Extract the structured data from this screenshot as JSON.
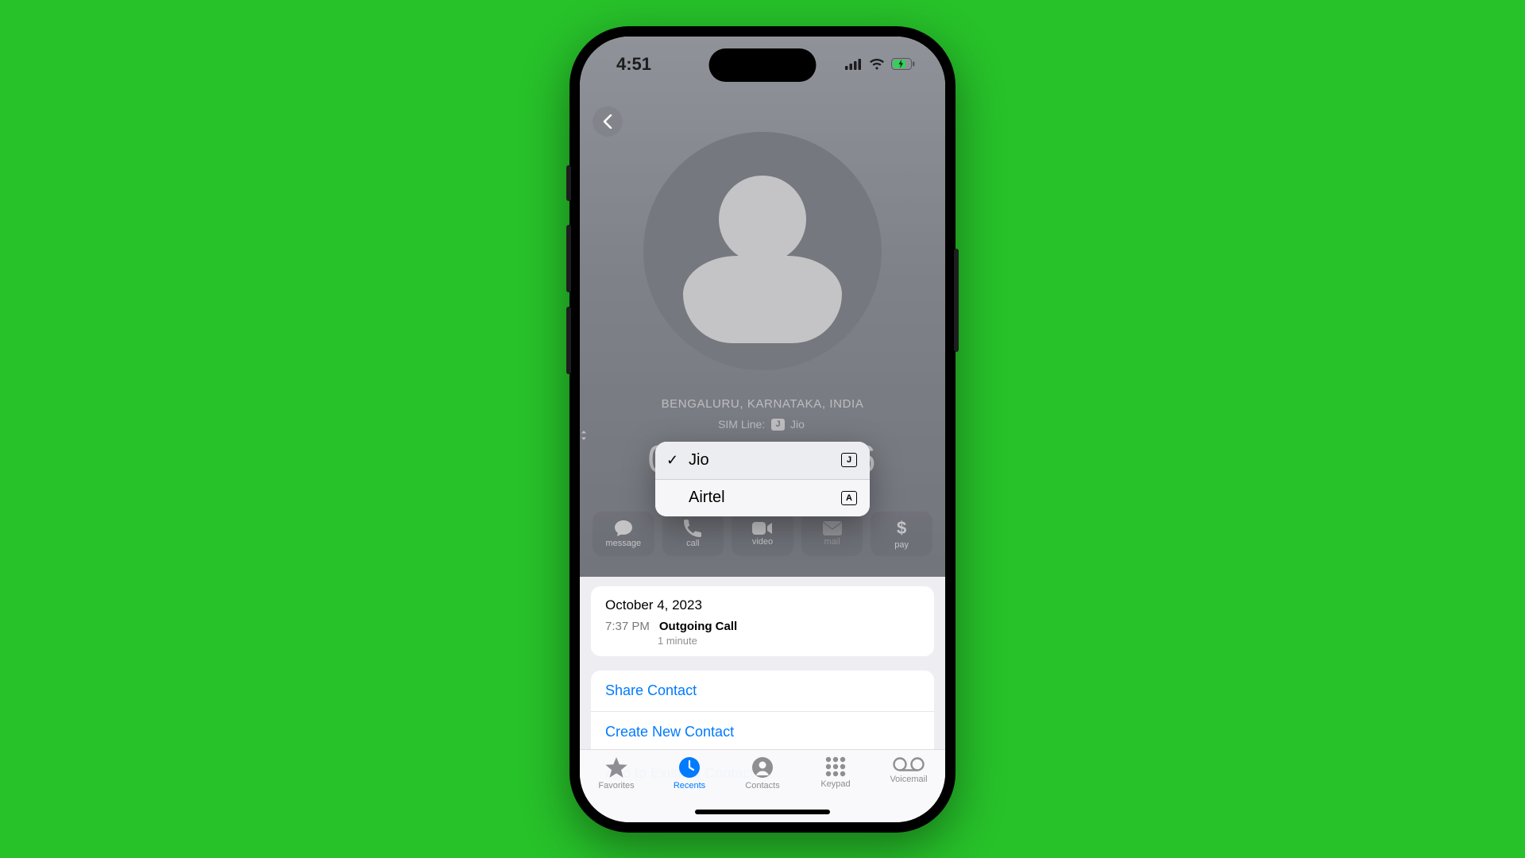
{
  "status": {
    "time": "4:51"
  },
  "header": {
    "location": "BENGALURU, KARNATAKA, INDIA",
    "sim_line_label": "SIM Line:",
    "sim_line_badge": "J",
    "sim_line_name": "Jio",
    "phone_left": "0",
    "phone_right": "6"
  },
  "actions": {
    "message": "message",
    "call": "call",
    "video": "video",
    "mail": "mail",
    "pay": "pay",
    "pay_symbol": "$"
  },
  "popover": {
    "items": [
      {
        "label": "Jio",
        "selected": true,
        "tag": "J"
      },
      {
        "label": "Airtel",
        "selected": false,
        "tag": "A"
      }
    ]
  },
  "log": {
    "date": "October 4, 2023",
    "time": "7:37 PM",
    "type": "Outgoing Call",
    "duration": "1 minute"
  },
  "links": {
    "share": "Share Contact",
    "create": "Create New Contact",
    "add": "Add to Existing Contact"
  },
  "tabs": {
    "favorites": "Favorites",
    "recents": "Recents",
    "contacts": "Contacts",
    "keypad": "Keypad",
    "voicemail": "Voicemail"
  }
}
